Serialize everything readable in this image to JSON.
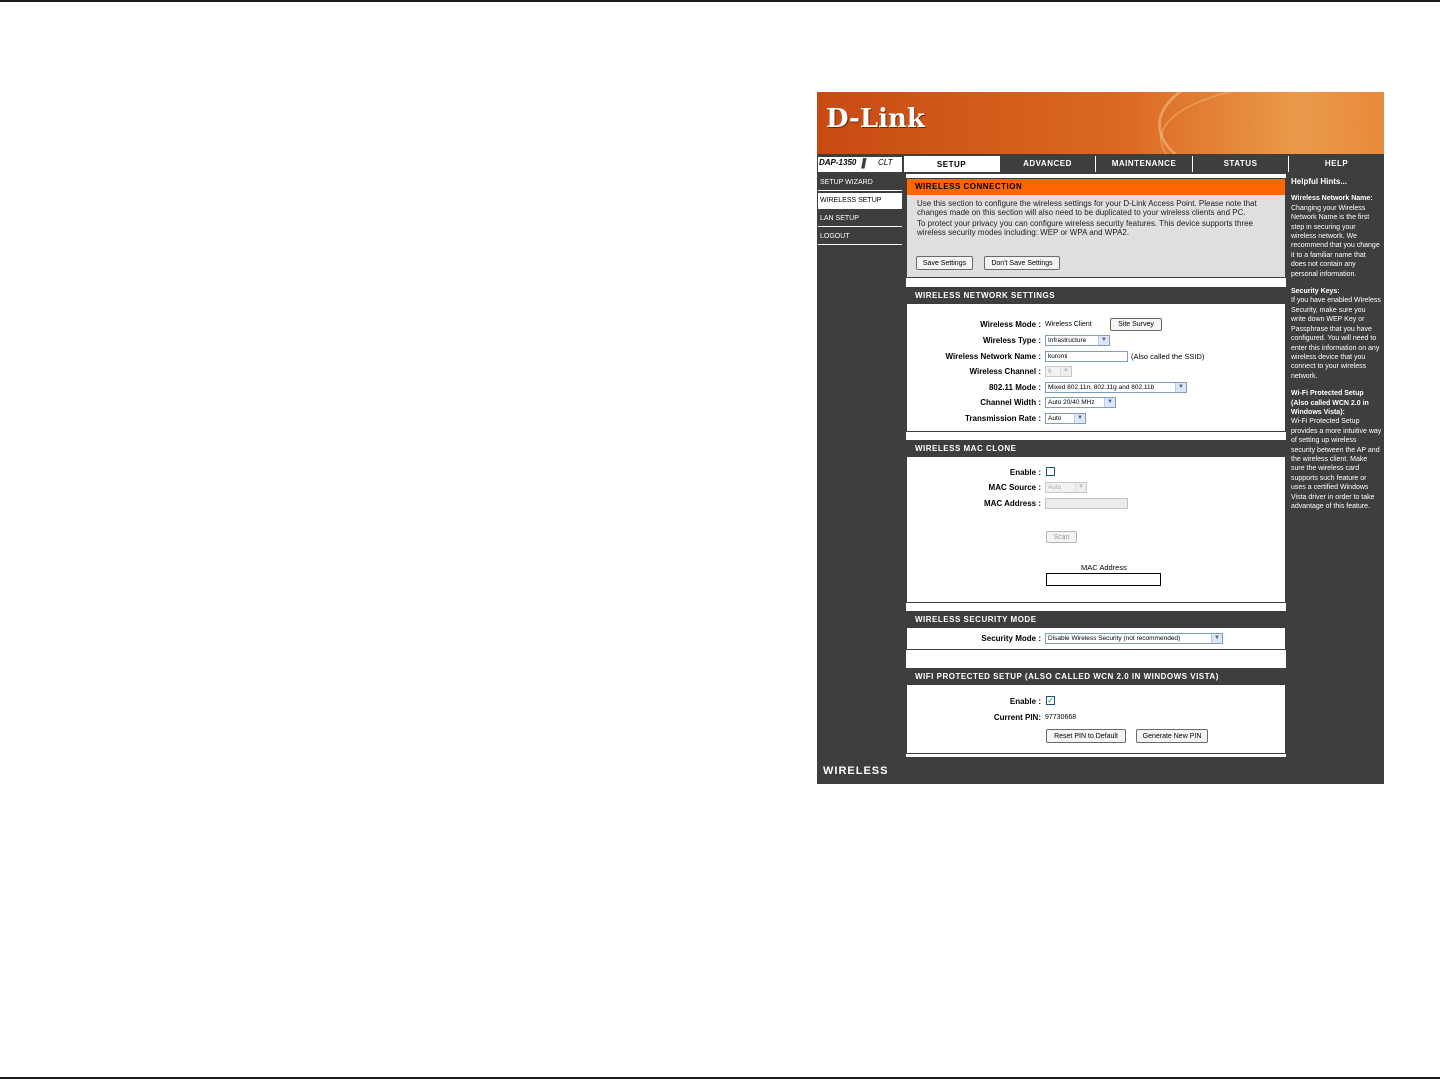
{
  "brand": {
    "logo": "D-Link",
    "model": "DAP-1350",
    "model_sub": "CLT"
  },
  "nav": {
    "tabs": [
      {
        "label": "SETUP"
      },
      {
        "label": "ADVANCED"
      },
      {
        "label": "MAINTENANCE"
      },
      {
        "label": "STATUS"
      },
      {
        "label": "HELP"
      }
    ]
  },
  "sidebar": {
    "items": [
      {
        "label": "SETUP WIZARD"
      },
      {
        "label": "WIRELESS SETUP"
      },
      {
        "label": "LAN SETUP"
      },
      {
        "label": "LOGOUT"
      }
    ]
  },
  "wireless_connection": {
    "title": "WIRELESS CONNECTION",
    "text1": "Use this section to configure the wireless settings for your D-Link Access Point. Please note that changes made on this section will also need to be duplicated to your wireless clients and PC.",
    "text2": "To protect your privacy you can configure wireless security features. This device supports three wireless security modes including: WEP or WPA and WPA2.",
    "save_label": "Save Settings",
    "dont_save_label": "Don't Save Settings"
  },
  "network_settings": {
    "title": "WIRELESS NETWORK SETTINGS",
    "mode_label": "Wireless Mode :",
    "mode_value": "Wireless Client",
    "site_survey_label": "Site Survey",
    "type_label": "Wireless Type :",
    "type_value": "Infrastructure",
    "name_label": "Wireless Network Name :",
    "name_value": "kuromi",
    "name_hint": "(Also called the SSID)",
    "channel_label": "Wireless Channel :",
    "channel_value": "6",
    "mode80211_label": "802.11 Mode :",
    "mode80211_value": "Mixed 802.11n, 802.11g and 802.11b",
    "width_label": "Channel Width :",
    "width_value": "Auto 20/40 MHz",
    "rate_label": "Transmission Rate :",
    "rate_value": "Auto"
  },
  "mac_clone": {
    "title": "WIRELESS MAC CLONE",
    "enable_label": "Enable :",
    "source_label": "MAC Source :",
    "source_value": "Auto",
    "address_label": "MAC Address :",
    "address_value": "",
    "scan_label": "Scan",
    "list_header": "MAC Address"
  },
  "security": {
    "title": "WIRELESS SECURITY MODE",
    "mode_label": "Security Mode :",
    "mode_value": "Disable Wireless Security (not recommended)"
  },
  "wps": {
    "title": "WIFI PROTECTED SETUP (ALSO CALLED WCN 2.0 IN WINDOWS VISTA)",
    "enable_label": "Enable :",
    "enable_mark": "✓",
    "pin_label": "Current PIN:",
    "pin_value": "97730668",
    "reset_label": "Reset PIN to Default",
    "generate_label": "Generate New PIN"
  },
  "help": {
    "heading": "Helpful Hints...",
    "t1": "Wireless Network Name:",
    "p1": "Changing your Wireless Network Name is the first step in securing your wireless network. We recommend that you change it to a familiar name that does not contain any personal information.",
    "t2": "Security Keys:",
    "p2": "If you have enabled Wireless Security, make sure you write down WEP Key or Passphrase that you have configured. You will need to enter this information on any wireless device that you connect to your wireless network.",
    "t3": "Wi-Fi Protected Setup (Also called WCN 2.0 in Windows Vista):",
    "p3": "Wi-Fi Protected Setup provides a more intuitive way of setting up wireless security between the AP and the wireless client. Make sure the wireless card supports such feature or uses a certified Windows Vista driver in order to take advantage of this feature."
  },
  "footer": {
    "label": "WIRELESS"
  }
}
